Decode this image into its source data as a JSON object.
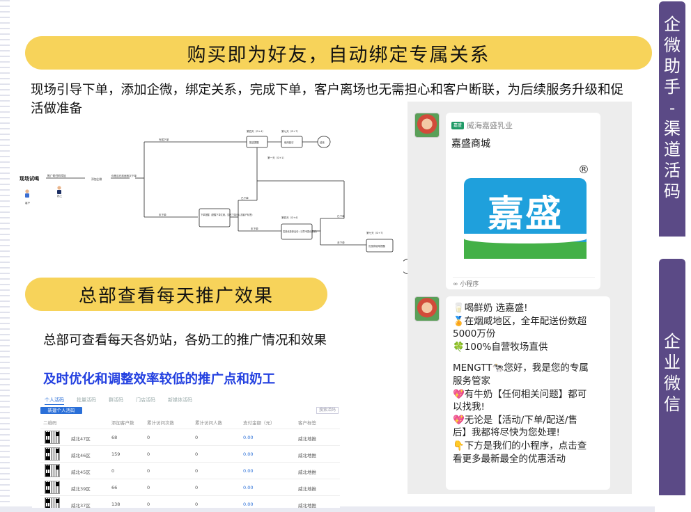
{
  "slide": {
    "banner_top": "购买即为好友，自动绑定专属关系",
    "para_top": "现场引导下单，添加企微，绑定关系，完成下单，客户离场也无需担心和客户断联，为后续服务升级和促活做准备",
    "banner_mid": "总部查看每天推广效果",
    "para_mid": "总部可查看每天各奶站，各奶工的推广情况和效果",
    "para_mid_highlight": "及时优化和调整效率较低的推广点和奶工"
  },
  "flowchart": {
    "start_label": "现场试喝",
    "customer_label": "客户",
    "staff_label": "奶工",
    "n_scan": "推广码扫码添加",
    "n_add": "添加企微",
    "n_question": "你是否在前面首次下单",
    "branch_done": "完成下单",
    "branch_not": "未下单",
    "day4_a": "第四天（D+4）",
    "n_delivery": "配送提醒",
    "day7_a": "第七天（D+7）",
    "n_followup": "使用回访",
    "n_end": "结束",
    "day1": "第一天（D+1）",
    "n_remind": "下单提醒（提醒下单文案，如不下单可以加客户标签）",
    "ordered": "已下单",
    "not_ordered": "未下单",
    "day4_b": "第四天（D+4）",
    "n_coupon": "发放优惠券活动（引导专属优惠券）",
    "ordered2": "已下单",
    "not_ordered2": "未下单",
    "day7_b": "第七天（D+7）",
    "n_coupon_remind": "优惠券使用提醒"
  },
  "table": {
    "tabs": [
      "个人活码",
      "批量活码",
      "群活码",
      "门店活码",
      "新媒体活码"
    ],
    "new_button": "新建个人活码",
    "export": "搜索活码",
    "headers": [
      "二维码",
      "添加客户数",
      "累计访问次数",
      "累计访问人数",
      "支付金额（元）",
      "客户标签"
    ],
    "rows": [
      {
        "name": "威北47区",
        "added": "68",
        "visits": "0",
        "visitors": "0",
        "amount": "0.00",
        "tag": "威北地推"
      },
      {
        "name": "威北46区",
        "added": "159",
        "visits": "0",
        "visitors": "0",
        "amount": "0.00",
        "tag": "威北地推"
      },
      {
        "name": "威北45区",
        "added": "0",
        "visits": "0",
        "visitors": "0",
        "amount": "0.00",
        "tag": "威北地推"
      },
      {
        "name": "威北39区",
        "added": "66",
        "visits": "0",
        "visitors": "0",
        "amount": "0.00",
        "tag": "威北地推"
      },
      {
        "name": "威北37区",
        "added": "138",
        "visits": "0",
        "visitors": "0",
        "amount": "0.00",
        "tag": "威北地推"
      }
    ]
  },
  "chat": {
    "mini_program": {
      "source": "威海嘉盛乳业",
      "logo_small": "嘉盛",
      "title": "嘉盛商城",
      "brand_text": "嘉盛",
      "reg_mark": "®",
      "footer": "小程序"
    },
    "message_lines": [
      "🥛喝鲜奶 选嘉盛!",
      "🏅在烟威地区，全年配送份数超",
      "5000万份",
      "🍀100%自营牧场直供",
      "",
      "MENGTT🐄您好，我是您的专属",
      "服务管家",
      "💖有牛奶【任何相关问题】都可",
      "以找我!",
      "💖无论是【活动/下单/配送/售",
      "后】我都将尽快为您处理!",
      "👇下方是我们的小程序，点击查",
      "看更多最新最全的优惠活动"
    ]
  },
  "sidebar": {
    "tag1": [
      "企",
      "微",
      "助",
      "手",
      "-",
      "渠",
      "道",
      "活",
      "码"
    ],
    "tag2": [
      "企",
      "业",
      "微",
      "信"
    ]
  },
  "colors": {
    "banner": "#f7d35a",
    "highlight": "#2340e0",
    "sidebar": "#5b4a86",
    "brand_blue": "#1fa0dc",
    "brand_green": "#43b047"
  }
}
